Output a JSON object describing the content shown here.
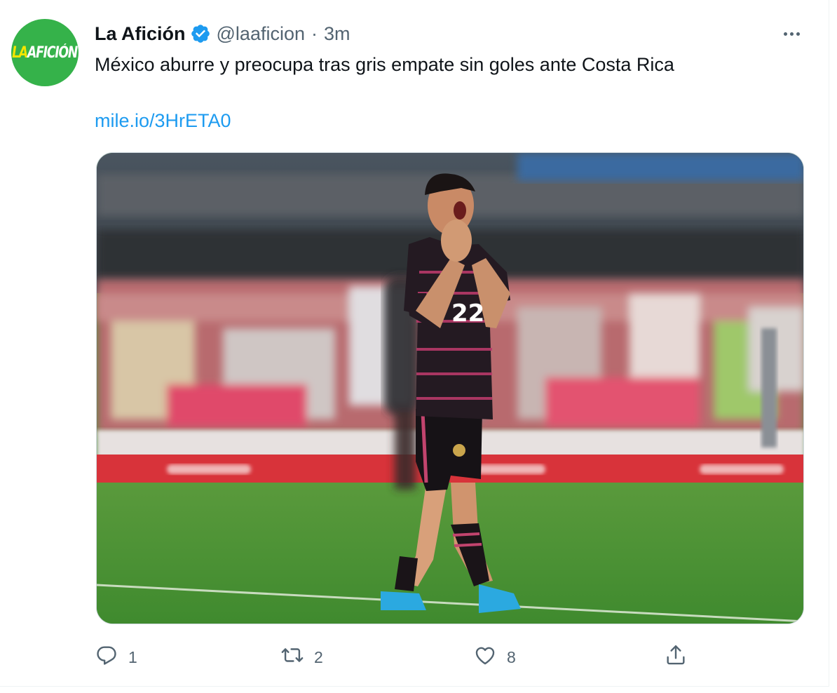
{
  "author": {
    "name": "La Afición",
    "handle": "@laaficion",
    "separator": "·",
    "time": "3m",
    "avatar_text_a": "LA",
    "avatar_text_b": "AFICIÓN",
    "avatar_color": "#35b24a",
    "verified_icon": "verified-badge-icon"
  },
  "tweet": {
    "text": "México aburre y preocupa tras gris empate sin goles ante Costa Rica",
    "link": "mile.io/3HrETA0",
    "link_color": "#1d9bf0"
  },
  "media": {
    "player_number": "22"
  },
  "actions": {
    "reply_count": "1",
    "retweet_count": "2",
    "like_count": "8",
    "icons": [
      "reply-icon",
      "retweet-icon",
      "like-icon",
      "share-icon"
    ]
  }
}
